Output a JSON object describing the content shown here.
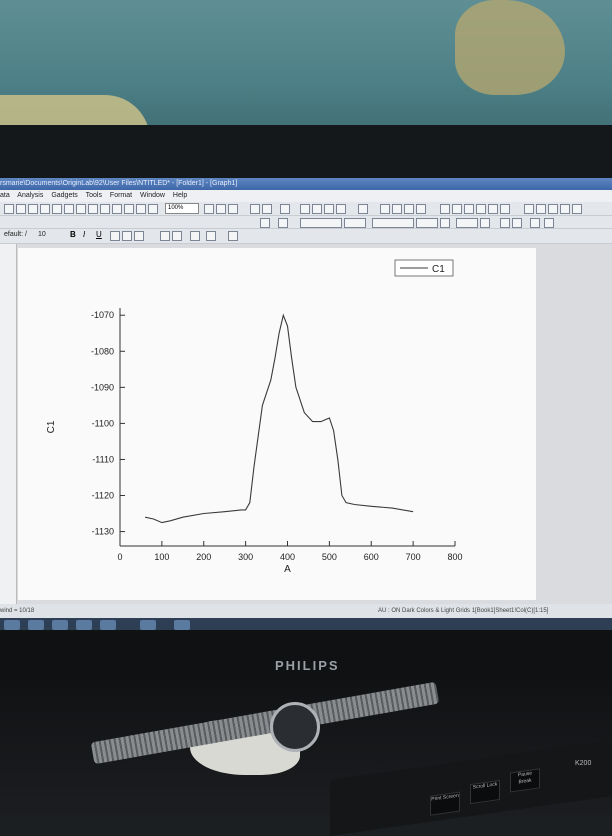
{
  "window": {
    "title": "rsmarie\\Documents\\OriginLab\\92\\User Files\\NTITLED* - [Folder1] - [Graph1]"
  },
  "menu": [
    "ata",
    "Analysis",
    "Gadgets",
    "Tools",
    "Format",
    "Window",
    "Help"
  ],
  "toolbar": {
    "zoom": "100%",
    "font": "efault: /",
    "font_size": "10",
    "bold": "B",
    "italic": "I",
    "underline": "U"
  },
  "statusbar": {
    "left": "wind = 10/18",
    "right": "AU : ON   Dark Colors & Light Grids   1[Book1]Sheet1!Col(C)[1:15]"
  },
  "monitor": {
    "brand": "PHILIPS",
    "model": "K200"
  },
  "keyboard": {
    "keys": [
      "Print Screen",
      "Scroll Lock",
      "Pause Break"
    ]
  },
  "colors": {
    "curve": "#3a3a3a",
    "titlebar": "#3e67a8",
    "page": "#fafafa"
  },
  "chart_data": {
    "type": "line",
    "series": [
      {
        "name": "C1",
        "x": [
          60,
          80,
          100,
          120,
          150,
          200,
          250,
          290,
          300,
          310,
          320,
          340,
          360,
          370,
          380,
          390,
          400,
          410,
          420,
          440,
          460,
          480,
          490,
          500,
          510,
          520,
          530,
          540,
          560,
          600,
          650,
          700
        ],
        "y": [
          -1126,
          -1126.5,
          -1127.5,
          -1127,
          -1126,
          -1125,
          -1124.5,
          -1124,
          -1124,
          -1122,
          -1112,
          -1095,
          -1088,
          -1082,
          -1075,
          -1070,
          -1073,
          -1082,
          -1090,
          -1097,
          -1099.5,
          -1099.5,
          -1099,
          -1098.5,
          -1102,
          -1110,
          -1120,
          -1122,
          -1122.5,
          -1123,
          -1123.5,
          -1124.5
        ]
      }
    ],
    "xlabel": "A",
    "ylabel": "C1",
    "xlim": [
      0,
      800
    ],
    "ylim": [
      -1134,
      -1068
    ],
    "xticks": [
      "0",
      "100",
      "200",
      "300",
      "400",
      "500",
      "600",
      "700",
      "800"
    ],
    "xtick_values": [
      0,
      100,
      200,
      300,
      400,
      500,
      600,
      700,
      800
    ],
    "yticks": [
      "-1070",
      "-1080",
      "-1090",
      "-1100",
      "-1110",
      "-1120",
      "-1130"
    ],
    "ytick_values": [
      -1070,
      -1080,
      -1090,
      -1100,
      -1110,
      -1120,
      -1130
    ],
    "legend": "top-right",
    "grid": false
  }
}
